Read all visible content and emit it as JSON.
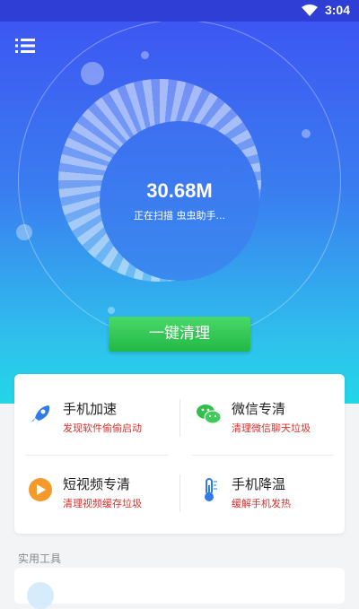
{
  "status_bar": {
    "time": "3:04",
    "wifi_icon": "wifi-icon"
  },
  "header": {
    "menu_icon": "menu-icon"
  },
  "scan": {
    "size": "30.68M",
    "status_text": "正在扫描 虫虫助手..."
  },
  "clean_button": {
    "label": "一键清理"
  },
  "features": [
    {
      "title": "手机加速",
      "subtitle": "发现软件偷偷启动",
      "icon": "rocket-icon"
    },
    {
      "title": "微信专清",
      "subtitle": "清理微信聊天垃圾",
      "icon": "wechat-icon"
    },
    {
      "title": "短视频专清",
      "subtitle": "清理视频缓存垃圾",
      "icon": "play-icon"
    },
    {
      "title": "手机降温",
      "subtitle": "缓解手机发热",
      "icon": "thermometer-icon"
    }
  ],
  "tools_section": {
    "label": "实用工具"
  },
  "colors": {
    "accent_blue": "#3d57f2",
    "accent_green": "#22b845",
    "subtitle_red": "#d9302b"
  }
}
